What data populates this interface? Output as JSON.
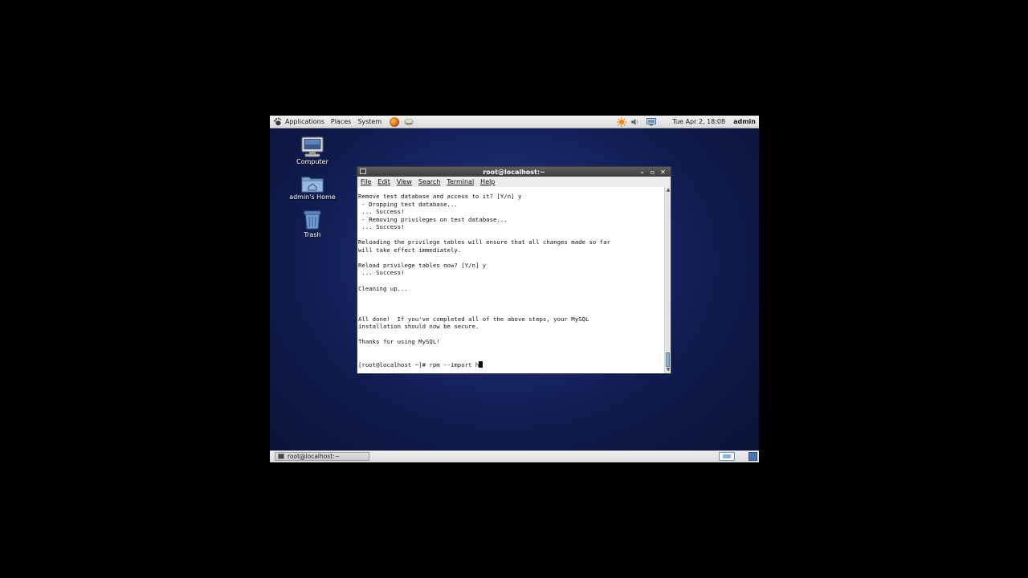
{
  "top_panel": {
    "menus": [
      "Applications",
      "Places",
      "System"
    ],
    "clock": "Tue Apr  2, 18:08",
    "user": "admin"
  },
  "desktop_icons": [
    {
      "label": "Computer"
    },
    {
      "label": "admin's Home"
    },
    {
      "label": "Trash"
    }
  ],
  "terminal": {
    "title": "root@localhost:~",
    "menu": [
      "File",
      "Edit",
      "View",
      "Search",
      "Terminal",
      "Help"
    ],
    "lines": [
      "Remove test database and access to it? [Y/n] y",
      " - Dropping test database...",
      " ... Success!",
      " - Removing privileges on test database...",
      " ... Success!",
      "",
      "Reloading the privilege tables will ensure that all changes made so far",
      "will take effect immediately.",
      "",
      "Reload privilege tables now? [Y/n] y",
      " ... Success!",
      "",
      "Cleaning up...",
      "",
      "",
      "",
      "All done!  If you've completed all of the above steps, your MySQL",
      "installation should now be secure.",
      "",
      "Thanks for using MySQL!",
      "",
      ""
    ],
    "prompt": "[root@localhost ~]# rpm --import h"
  },
  "taskbar": {
    "window_button": "root@localhost:~"
  },
  "colors": {
    "desktop_center": "#2a3f8a",
    "desktop_edge": "#0a1233",
    "titlebar": "#4a4a4a",
    "scroll_thumb": "#6e9fd0"
  }
}
